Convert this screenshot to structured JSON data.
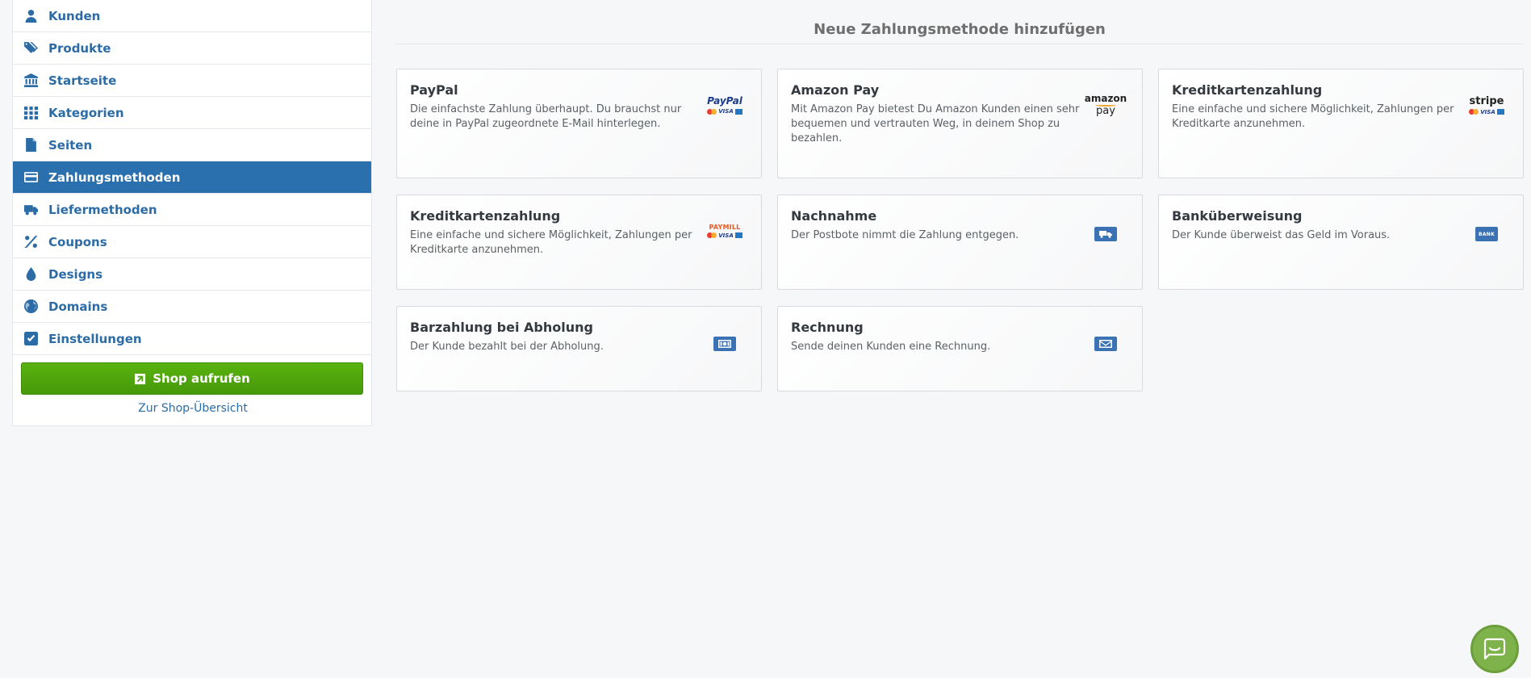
{
  "sidebar": {
    "items": [
      {
        "label": "Kunden",
        "icon": "user-icon"
      },
      {
        "label": "Produkte",
        "icon": "tags-icon"
      },
      {
        "label": "Startseite",
        "icon": "bank-building-icon"
      },
      {
        "label": "Kategorien",
        "icon": "grid-icon"
      },
      {
        "label": "Seiten",
        "icon": "file-icon"
      },
      {
        "label": "Zahlungsmethoden",
        "icon": "credit-card-icon",
        "active": true
      },
      {
        "label": "Liefermethoden",
        "icon": "truck-icon"
      },
      {
        "label": "Coupons",
        "icon": "percent-icon"
      },
      {
        "label": "Designs",
        "icon": "tint-drop-icon"
      },
      {
        "label": "Domains",
        "icon": "globe-icon"
      },
      {
        "label": "Einstellungen",
        "icon": "check-square-icon"
      }
    ],
    "shop_button": "Shop aufrufen",
    "overview_link": "Zur Shop-Übersicht"
  },
  "main": {
    "title": "Neue Zahlungsmethode hinzufügen",
    "cards": [
      {
        "title": "PayPal",
        "desc": "Die einfachste Zahlung überhaupt. Du brauchst nur deine in PayPal zugeordnete E-Mail hinterlegen.",
        "logo": "paypal-logo",
        "logo_text": "PayPal"
      },
      {
        "title": "Amazon Pay",
        "desc": "Mit Amazon Pay bietest Du Amazon Kunden einen sehr bequemen und vertrauten Weg, in deinem Shop zu bezahlen.",
        "logo": "amazon-pay-logo",
        "logo_text_1": "amazon",
        "logo_text_2": "pay"
      },
      {
        "title": "Kreditkartenzahlung",
        "desc": "Eine einfache und sichere Möglichkeit, Zahlungen per Kreditkarte anzunehmen.",
        "logo": "stripe-logo",
        "logo_text": "stripe"
      },
      {
        "title": "Kreditkartenzahlung",
        "desc": "Eine einfache und sichere Möglichkeit, Zahlungen per Kreditkarte anzunehmen.",
        "logo": "paymill-logo",
        "logo_text": "PAYMILL"
      },
      {
        "title": "Nachnahme",
        "desc": "Der Postbote nimmt die Zahlung entgegen.",
        "logo": "delivery-truck-icon"
      },
      {
        "title": "Banküberweisung",
        "desc": "Der Kunde überweist das Geld im Voraus.",
        "logo": "bank-icon",
        "logo_text": "BANK"
      },
      {
        "title": "Barzahlung bei Abholung",
        "desc": "Der Kunde bezahlt bei der Abholung.",
        "logo": "cash-icon"
      },
      {
        "title": "Rechnung",
        "desc": "Sende deinen Kunden eine Rechnung.",
        "logo": "envelope-icon"
      }
    ]
  },
  "colors": {
    "accent": "#2a6fae",
    "link": "#2c6ca6",
    "shop_button": "#51a80c",
    "chat": "#7db34a"
  },
  "chat": {
    "icon": "chat-bubble-icon"
  }
}
